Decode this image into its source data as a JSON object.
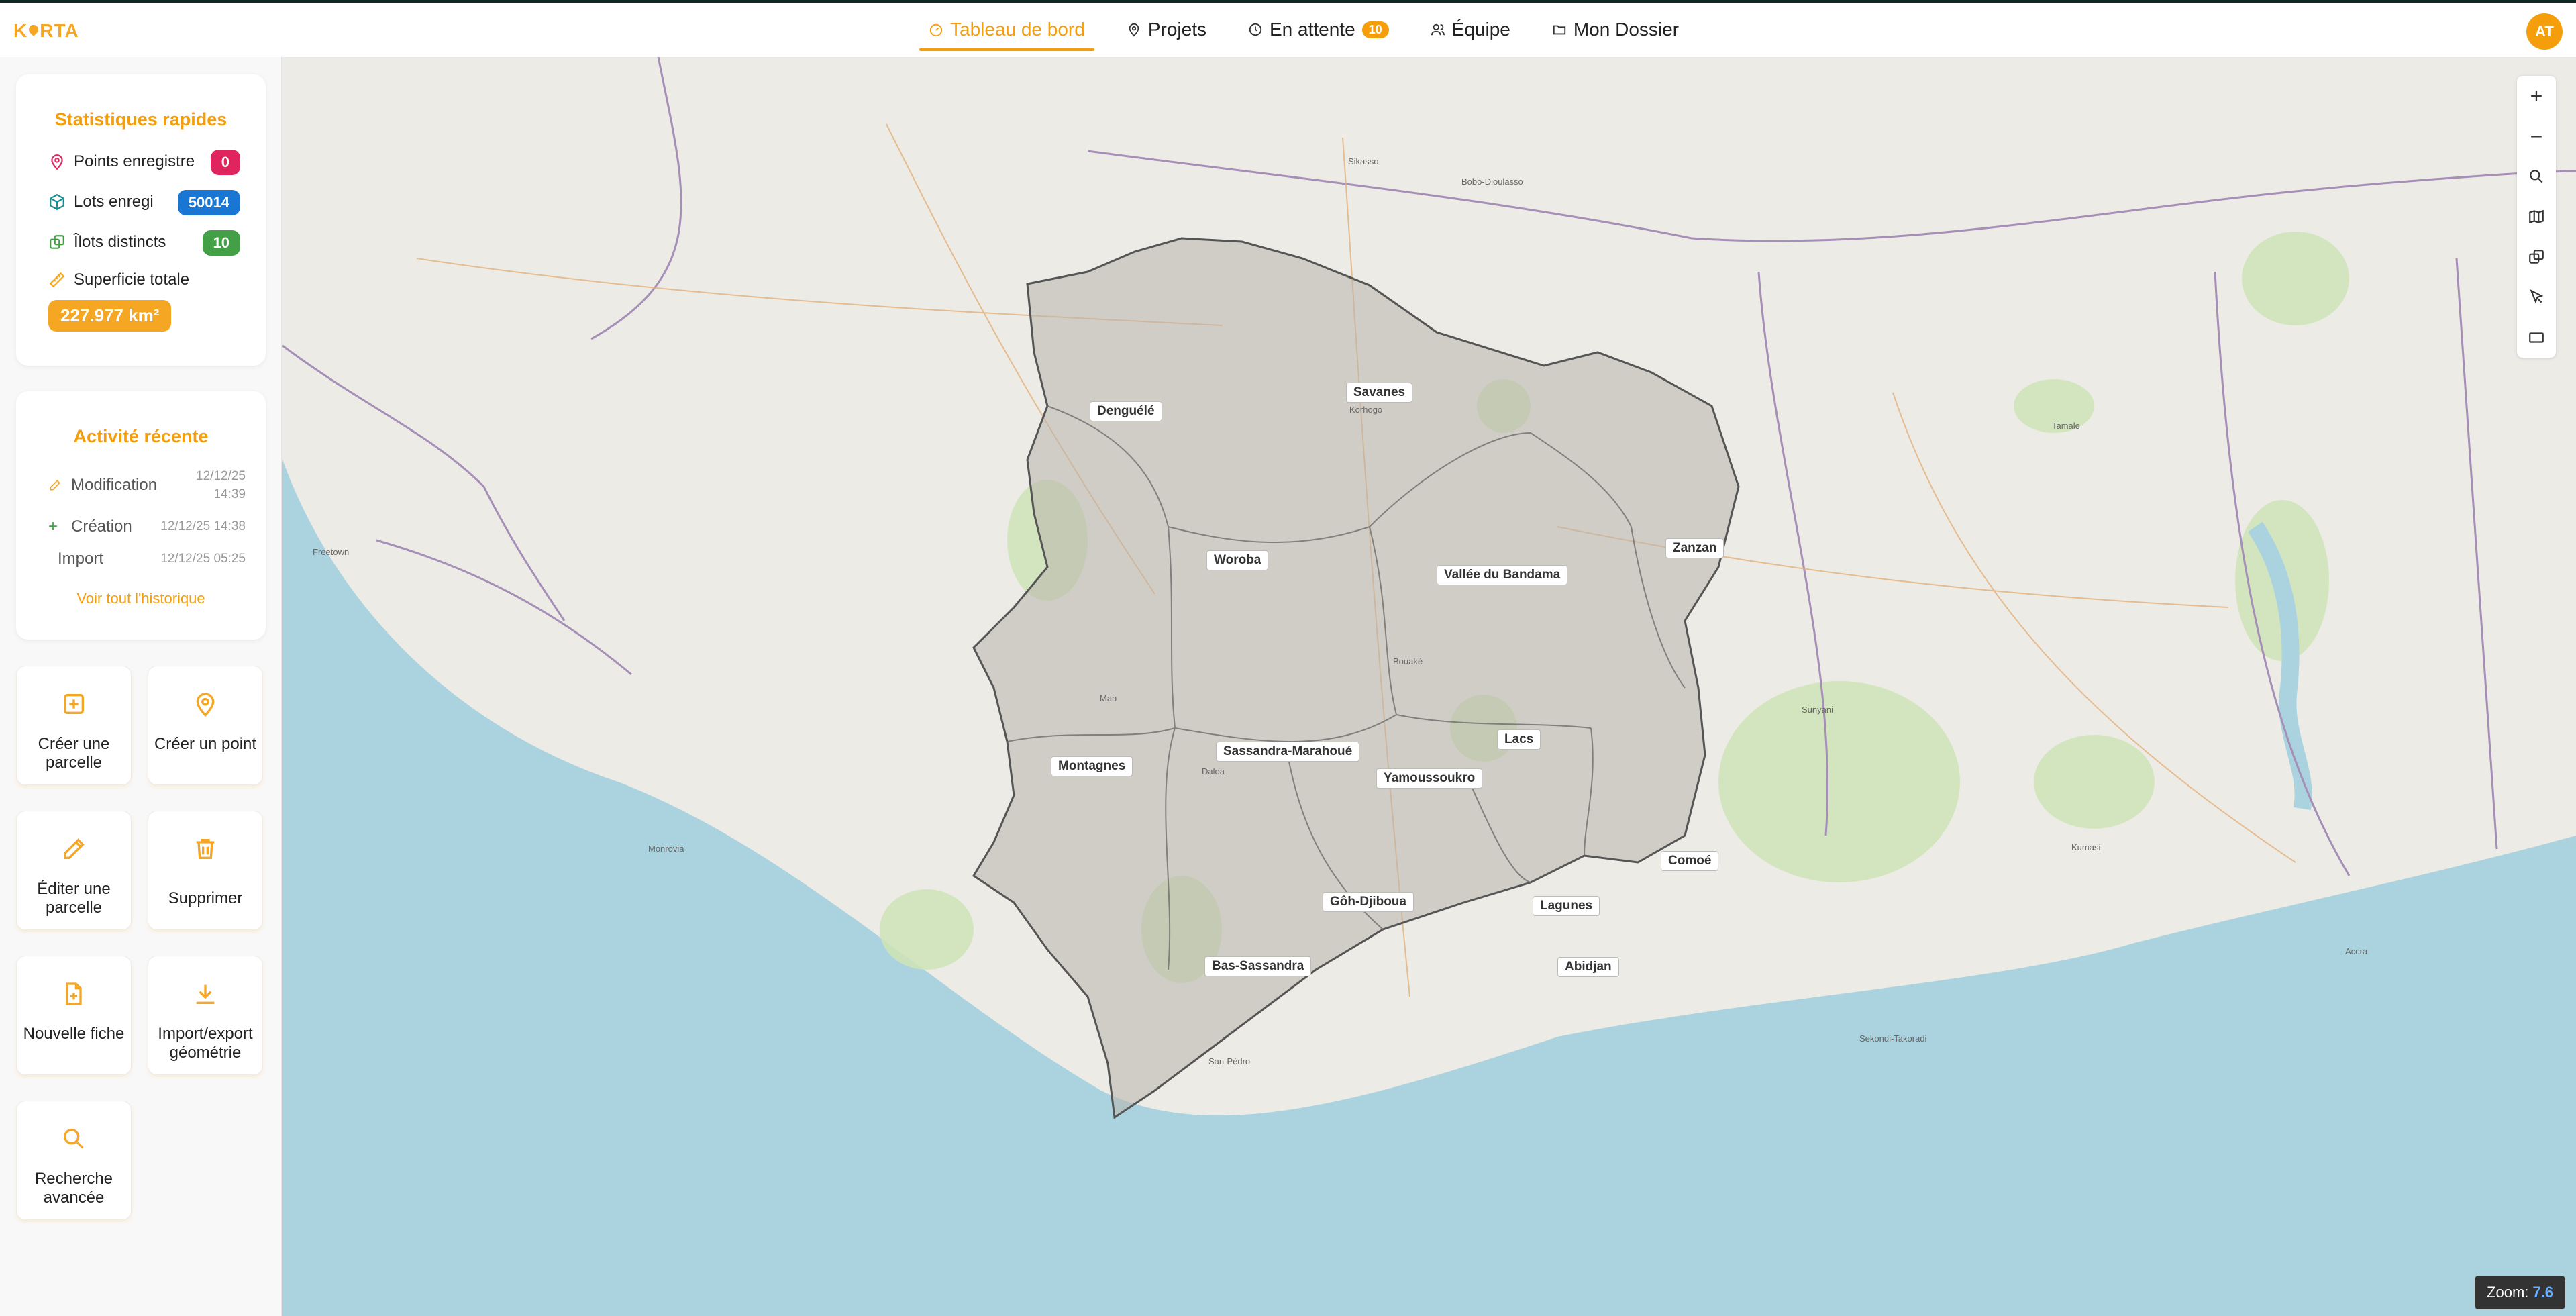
{
  "app": {
    "logo": "KARTA",
    "avatar_initials": "AT"
  },
  "nav": {
    "items": [
      {
        "label": "Tableau de bord",
        "icon": "dashboard-icon",
        "active": true
      },
      {
        "label": "Projets",
        "icon": "map-pin-icon"
      },
      {
        "label": "En attente",
        "icon": "clock-icon",
        "badge": "10"
      },
      {
        "label": "Équipe",
        "icon": "users-icon"
      },
      {
        "label": "Mon Dossier",
        "icon": "folder-icon"
      }
    ]
  },
  "stats": {
    "title": "Statistiques rapides",
    "points_label": "Points enregistre",
    "points_value": "0",
    "lots_label": "Lots enregi",
    "lots_value": "50014",
    "ilots_label": "Îlots distincts",
    "ilots_value": "10",
    "superficie_label": "Superficie totale",
    "superficie_value": "227.977 km²",
    "colors": {
      "points": "#e0245e",
      "lots": "#1976d2",
      "ilots": "#43a047",
      "superficie": "#f5a623"
    }
  },
  "activity": {
    "title": "Activité récente",
    "items": [
      {
        "label": "Modification",
        "time_line1": "12/12/25",
        "time_line2": "14:39",
        "icon": "edit-icon"
      },
      {
        "label": "Création",
        "time": "12/12/25 14:38",
        "icon": "plus-icon"
      },
      {
        "label": "Import",
        "time": "12/12/25 05:25"
      }
    ],
    "history_link": "Voir tout l'historique"
  },
  "actions": {
    "create_parcel": "Créer une parcelle",
    "create_point": "Créer un point",
    "edit_parcel": "Éditer une parcelle",
    "delete": "Supprimer",
    "new_sheet": "Nouvelle fiche",
    "import_export": "Import/export géométrie",
    "advanced_search": "Recherche avancée"
  },
  "map": {
    "regions": {
      "denguele": "Denguélé",
      "savanes": "Savanes",
      "woroba": "Woroba",
      "bandama": "Vallée du Bandama",
      "zanzan": "Zanzan",
      "montagnes": "Montagnes",
      "sassandra": "Sassandra-Marahoué",
      "lacs": "Lacs",
      "yamoussoukro": "Yamoussoukro",
      "comoe": "Comoé",
      "goh": "Gôh-Djiboua",
      "lagunes": "Lagunes",
      "bas_sassandra": "Bas-Sassandra",
      "abidjan": "Abidjan"
    },
    "cities": {
      "korhogo": "Korhogo",
      "bouake": "Bouaké",
      "man": "Man",
      "daloa": "Daloa",
      "sanpedro": "San-Pédro",
      "freetown": "Freetown",
      "monrovia": "Monrovia",
      "tamale": "Tamale",
      "sikasso": "Sikasso",
      "bobo": "Bobo-Dioulasso",
      "kumasi": "Kumasi",
      "accra": "Accra",
      "takoradi": "Sekondi-Takoradi",
      "sunyani": "Sunyani"
    },
    "zoom_label": "Zoom:",
    "zoom_value": "7.6"
  }
}
